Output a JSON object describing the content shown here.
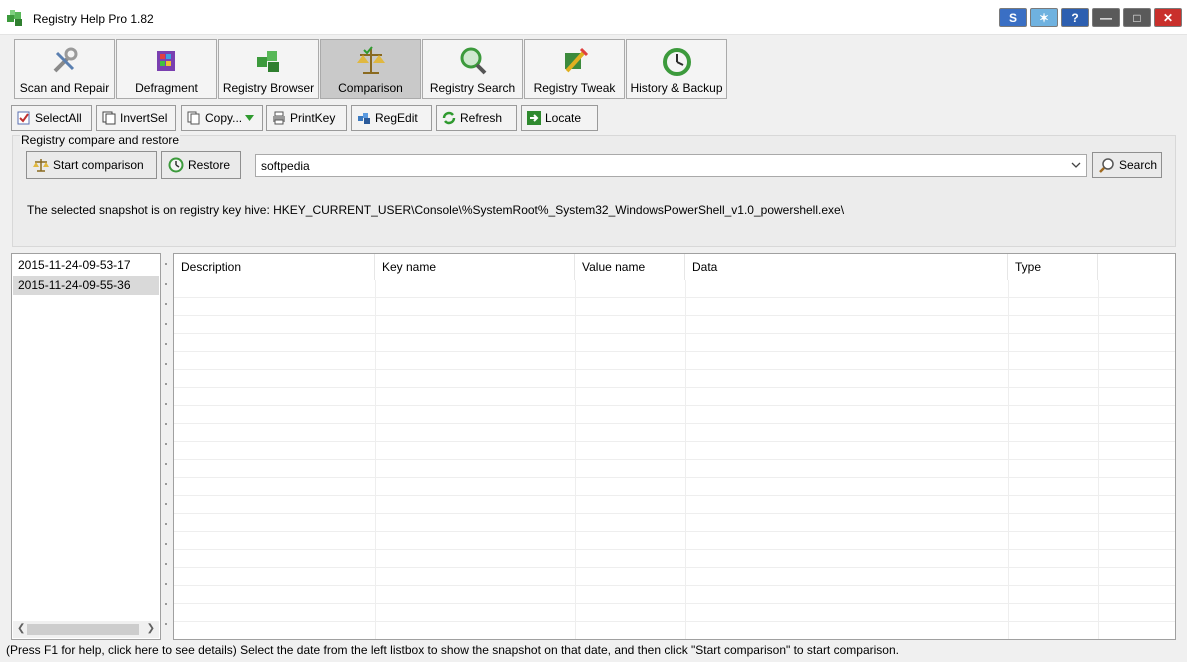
{
  "window": {
    "title": "Registry Help Pro 1.82",
    "controls": [
      {
        "name": "skin-icon",
        "glyph": "S",
        "color": "#3a6fc4"
      },
      {
        "name": "theme-icon",
        "glyph": "✶",
        "color": "#4fa0d8"
      },
      {
        "name": "help-icon",
        "glyph": "?",
        "color": "#2d5fb0"
      },
      {
        "name": "minimize-icon",
        "glyph": "—",
        "color": "#4c4c4c"
      },
      {
        "name": "maximize-icon",
        "glyph": "□",
        "color": "#4c4c4c"
      },
      {
        "name": "close-icon",
        "glyph": "✕",
        "color": "#c9302c"
      }
    ]
  },
  "tabs": [
    {
      "label": "Scan and Repair",
      "icon": "wrench-screwdriver-icon",
      "active": false
    },
    {
      "label": "Defragment",
      "icon": "defragment-icon",
      "active": false
    },
    {
      "label": "Registry Browser",
      "icon": "registry-cubes-icon",
      "active": false
    },
    {
      "label": "Comparison",
      "icon": "scales-icon",
      "active": true
    },
    {
      "label": "Registry Search",
      "icon": "magnifier-icon",
      "active": false
    },
    {
      "label": "Registry Tweak",
      "icon": "tweak-icon",
      "active": false
    },
    {
      "label": "History & Backup",
      "icon": "clock-icon",
      "active": false
    }
  ],
  "toolbar": {
    "select_all": "SelectAll",
    "invert_sel": "InvertSel",
    "copy": "Copy...",
    "print_key": "PrintKey",
    "reg_edit": "RegEdit",
    "refresh": "Refresh",
    "locate": "Locate"
  },
  "compare": {
    "group_title": "Registry compare and restore",
    "start_label": "Start comparison",
    "restore_label": "Restore",
    "search_value": "softpedia",
    "search_label": "Search",
    "hive_text": "The selected snapshot is on registry key hive: HKEY_CURRENT_USER\\Console\\%SystemRoot%_System32_WindowsPowerShell_v1.0_powershell.exe\\"
  },
  "snapshots": {
    "items": [
      "2015-11-24-09-53-17",
      "2015-11-24-09-55-36"
    ],
    "selected": 1
  },
  "grid": {
    "columns": [
      "Description",
      "Key name",
      "Value name",
      "Data",
      "Type"
    ]
  },
  "status": "(Press F1 for help, click here to see details) Select the date from the left listbox to show the snapshot on that date, and then click \"Start comparison\" to start comparison.",
  "colors": {
    "accent": "#3a6fc4",
    "active_tab": "#c9c9c9"
  }
}
